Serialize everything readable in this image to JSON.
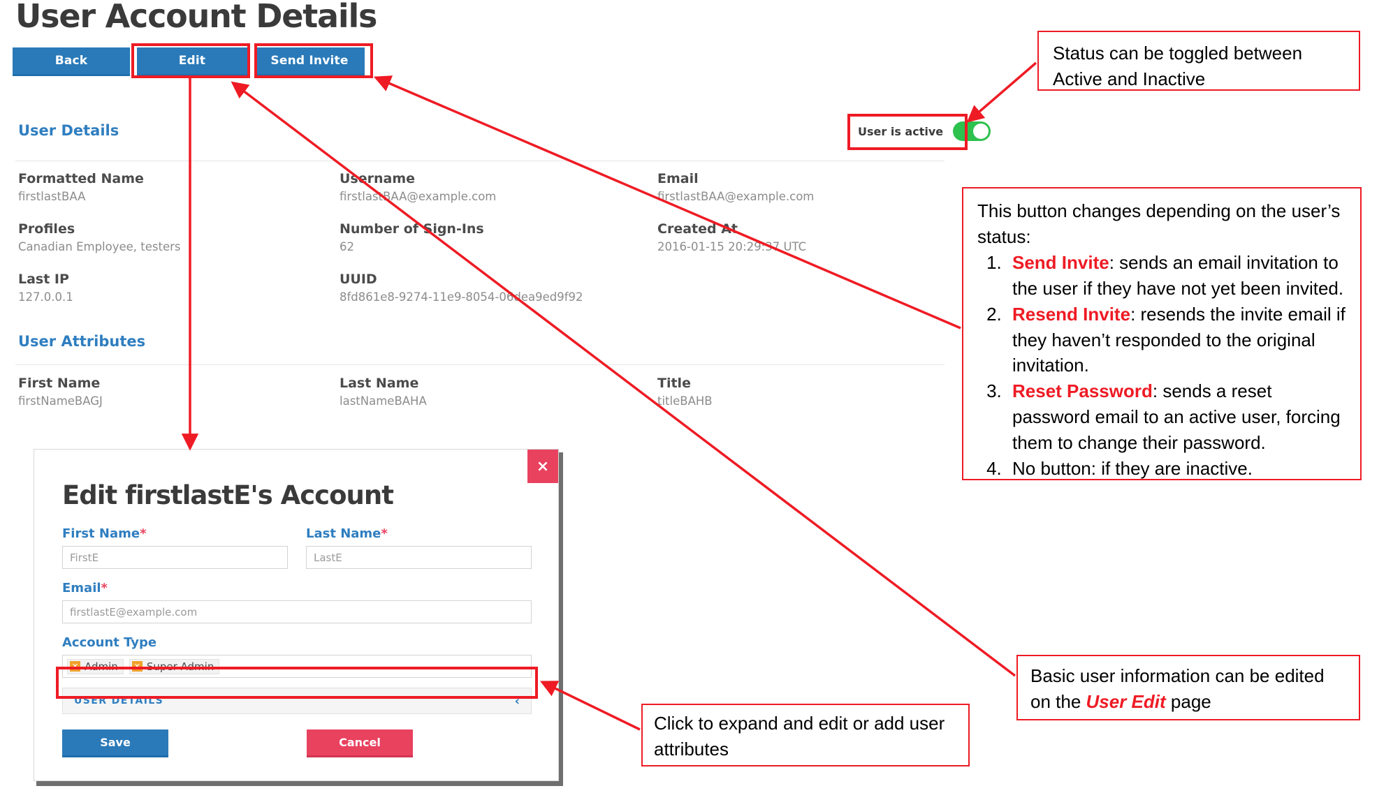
{
  "page": {
    "title": "User Account Details"
  },
  "toolbar": {
    "back_label": "Back",
    "edit_label": "Edit",
    "send_invite_label": "Send Invite"
  },
  "status_toggle": {
    "label": "User is active",
    "state": "on",
    "on_color": "#2dc14e"
  },
  "sections": {
    "user_details_heading": "User Details",
    "user_attributes_heading": "User Attributes"
  },
  "user_details": [
    {
      "label": "Formatted Name",
      "value": "firstlastBAA"
    },
    {
      "label": "Username",
      "value": "firstlastBAA@example.com"
    },
    {
      "label": "Email",
      "value": "firstlastBAA@example.com"
    },
    {
      "label": "Profiles",
      "value": "Canadian Employee, testers"
    },
    {
      "label": "Number of Sign-Ins",
      "value": "62"
    },
    {
      "label": "Created At",
      "value": "2016-01-15 20:29:37 UTC"
    },
    {
      "label": "Last IP",
      "value": "127.0.0.1"
    },
    {
      "label": "UUID",
      "value": "8fd861e8-9274-11e9-8054-06dea9ed9f92"
    },
    {
      "label": "",
      "value": ""
    }
  ],
  "user_attributes": [
    {
      "label": "First Name",
      "value": "firstNameBAGJ"
    },
    {
      "label": "Last Name",
      "value": "lastNameBAHA"
    },
    {
      "label": "Title",
      "value": "titleBAHB"
    }
  ],
  "modal": {
    "title": "Edit firstlastE's Account",
    "close_label": "×",
    "fields": {
      "first_name_label": "First Name",
      "first_name_value": "FirstE",
      "last_name_label": "Last Name",
      "last_name_value": "LastE",
      "email_label": "Email",
      "email_value": "firstlastE@example.com",
      "account_type_label": "Account Type",
      "required_marker": "*"
    },
    "account_type_tags": [
      {
        "label": "Admin",
        "remove": "✕"
      },
      {
        "label": "Super Admin",
        "remove": "✕"
      }
    ],
    "accordion": {
      "label": "USER  DETAILS",
      "chevron": "‹"
    },
    "save_label": "Save",
    "cancel_label": "Cancel"
  },
  "annotations": {
    "status_note": "Status can be toggled between Active and Inactive",
    "button_note": {
      "intro": "This button changes depending on the user’s status:",
      "items": [
        {
          "term": "Send Invite",
          "rest": ": sends an email invitation to the user if they have not yet been invited."
        },
        {
          "term": "Resend Invite",
          "rest": ": resends the invite email if they haven’t responded to the original invitation."
        },
        {
          "term": "Reset Password",
          "rest": ": sends a reset password email to an active user, forcing them to change their password."
        },
        {
          "term": "",
          "rest": "No button: if they are inactive."
        }
      ]
    },
    "basic_info_note_pre": "Basic user information can be edited on the ",
    "basic_info_note_em": "User Edit",
    "basic_info_note_post": " page",
    "expand_note": "Click to expand and edit or add user attributes",
    "accent_color": "#ee1b24"
  }
}
